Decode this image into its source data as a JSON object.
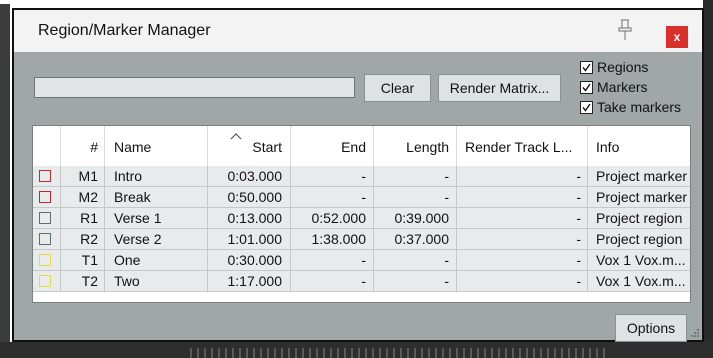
{
  "window": {
    "title": "Region/Marker Manager",
    "close_label": "x"
  },
  "toolbar": {
    "search_value": "",
    "clear_label": "Clear",
    "render_matrix_label": "Render Matrix...",
    "options_label": "Options"
  },
  "filters": [
    {
      "label": "Regions",
      "checked": true
    },
    {
      "label": "Markers",
      "checked": true
    },
    {
      "label": "Take markers",
      "checked": true
    }
  ],
  "table": {
    "columns": [
      "",
      "#",
      "Name",
      "Start",
      "End",
      "Length",
      "Render Track L...",
      "Info"
    ],
    "rows": [
      {
        "color": "#c0282d",
        "id": "M1",
        "name": "Intro",
        "start": "0:03.000",
        "end": "-",
        "length": "-",
        "render": "-",
        "info": "Project marker"
      },
      {
        "color": "#c0282d",
        "id": "M2",
        "name": "Break",
        "start": "0:50.000",
        "end": "-",
        "length": "-",
        "render": "-",
        "info": "Project marker"
      },
      {
        "color": "#5e6e6e",
        "id": "R1",
        "name": "Verse 1",
        "start": "0:13.000",
        "end": "0:52.000",
        "length": "0:39.000",
        "render": "-",
        "info": "Project region"
      },
      {
        "color": "#5e6e6e",
        "id": "R2",
        "name": "Verse 2",
        "start": "1:01.000",
        "end": "1:38.000",
        "length": "0:37.000",
        "render": "-",
        "info": "Project region"
      },
      {
        "color": "#e8d84a",
        "id": "T1",
        "name": "One",
        "start": "0:30.000",
        "end": "-",
        "length": "-",
        "render": "-",
        "info": "Vox 1 Vox.m..."
      },
      {
        "color": "#e8d84a",
        "id": "T2",
        "name": "Two",
        "start": "1:17.000",
        "end": "-",
        "length": "-",
        "render": "-",
        "info": "Vox 1 Vox.m..."
      }
    ]
  }
}
